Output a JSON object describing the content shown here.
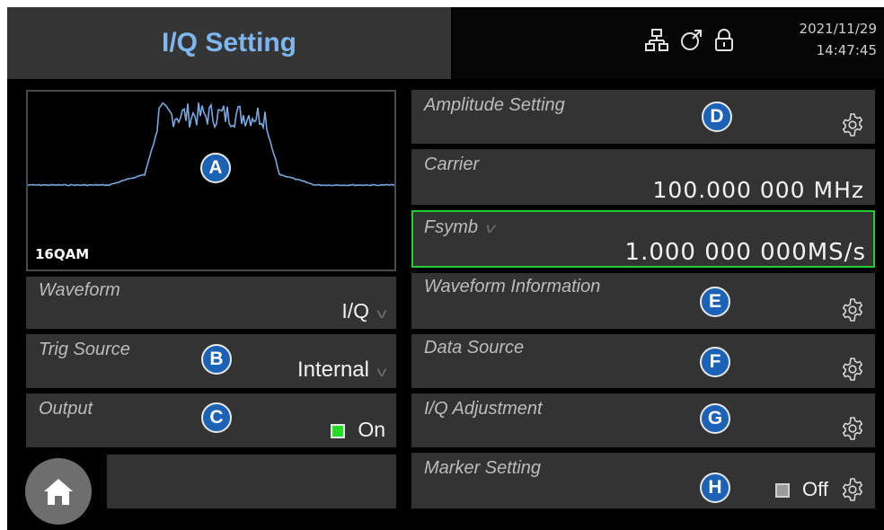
{
  "header": {
    "title": "I/Q Setting",
    "date": "2021/11/29",
    "time": "14:47:45",
    "status_icons": [
      "network-icon",
      "external-ref-icon",
      "lock-icon"
    ]
  },
  "spectrum": {
    "modulation_label": "16QAM",
    "badge": "A"
  },
  "left_panels": {
    "waveform": {
      "label": "Waveform",
      "value": "I/Q"
    },
    "trig_source": {
      "label": "Trig Source",
      "value": "Internal",
      "badge": "B"
    },
    "output": {
      "label": "Output",
      "value": "On",
      "badge": "C",
      "state": "on"
    }
  },
  "right_panels": {
    "amplitude": {
      "label": "Amplitude Setting",
      "badge": "D"
    },
    "carrier": {
      "label": "Carrier",
      "value": "100.000 000 MHz"
    },
    "fsymb": {
      "label": "Fsymb",
      "value": "1.000 000 000MS/s"
    },
    "waveform_info": {
      "label": "Waveform Information",
      "badge": "E"
    },
    "data_source": {
      "label": "Data Source",
      "badge": "F"
    },
    "iq_adjustment": {
      "label": "I/Q Adjustment",
      "badge": "G"
    },
    "marker": {
      "label": "Marker Setting",
      "badge": "H",
      "value": "Off",
      "state": "off"
    }
  },
  "colors": {
    "title_blue": "#7eb6ee",
    "badge_blue": "#1c63b7",
    "panel": "#333333",
    "active_border": "#22cc33",
    "trace": "#7aa7dd"
  }
}
